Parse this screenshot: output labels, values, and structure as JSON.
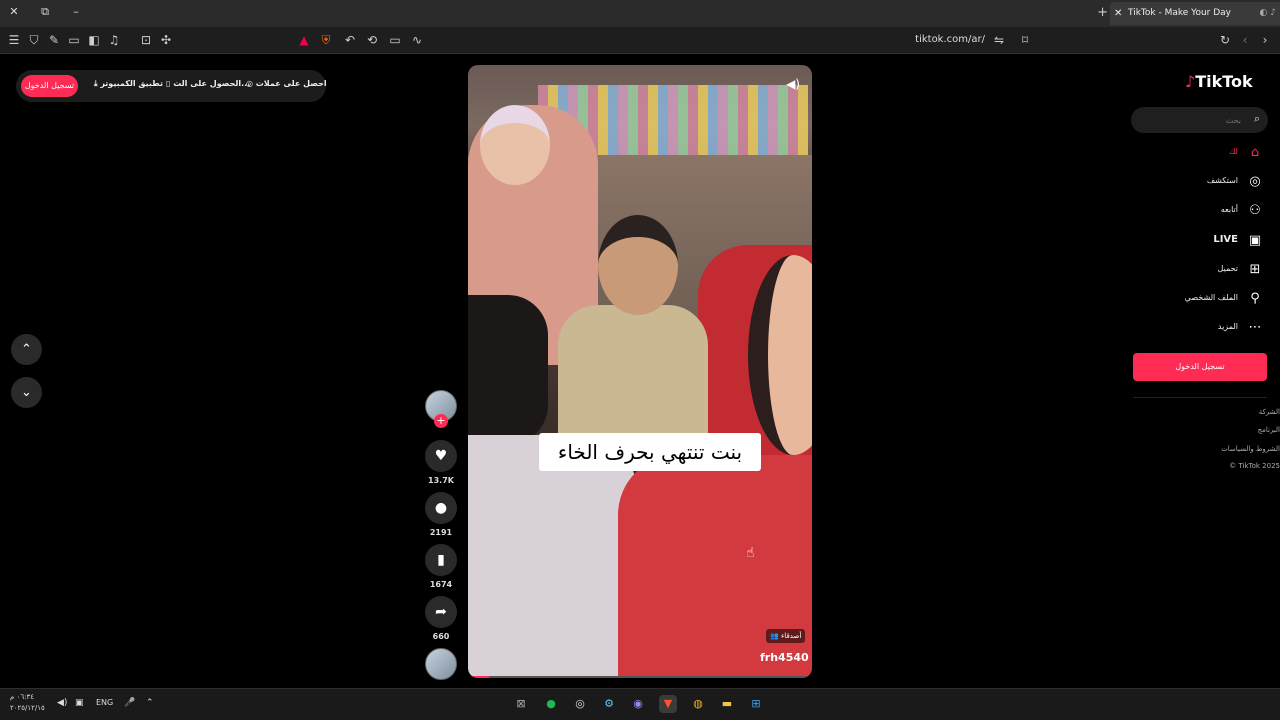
{
  "browser": {
    "tab_title": "TikTok - Make Your Day",
    "url": "tiktok.com/ar/",
    "new_tab": "+",
    "close_window": "✕",
    "minimize": "–"
  },
  "topbar": {
    "get_coins": "احصل على عملات",
    "get_app": "الحصول على الت...",
    "desktop_app": "تطبيق الكمبيوتر",
    "login": "تسجيل الدخول"
  },
  "video": {
    "caption": "بنت تنتهي بحرف الخاء",
    "friends_badge": "أصدقاء",
    "author": "frh4540",
    "progress": 0.06
  },
  "actions": {
    "likes": "13.7K",
    "comments": "2191",
    "saves": "1674",
    "shares": "660"
  },
  "sidebar": {
    "logo": "TikTok",
    "search_placeholder": "بحث",
    "items": [
      {
        "label": "لك",
        "icon": "home-icon"
      },
      {
        "label": "استكشف",
        "icon": "compass-icon"
      },
      {
        "label": "أتابعه",
        "icon": "following-icon"
      },
      {
        "label": "LIVE",
        "icon": "live-icon"
      },
      {
        "label": "تحميل",
        "icon": "upload-icon"
      },
      {
        "label": "الملف الشخصي",
        "icon": "profile-icon"
      },
      {
        "label": "المزيد",
        "icon": "more-icon"
      }
    ],
    "login": "تسجيل الدخول",
    "footer": [
      "الشركة",
      "البرنامج",
      "الشروط والسياسات",
      "© TikTok 2025"
    ]
  },
  "taskbar": {
    "time": "٠٦:٣٤ م",
    "date": "٢٠٢٥/١٢/١٥",
    "language": "ENG"
  },
  "colors": {
    "accent": "#fe2c55",
    "background": "#000000"
  }
}
